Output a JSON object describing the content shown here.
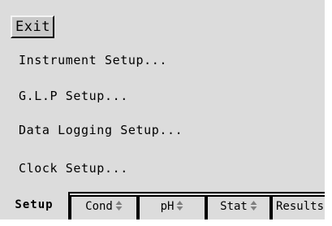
{
  "exit_button": {
    "label": "Exit"
  },
  "menu": {
    "items": [
      {
        "label": "Instrument Setup..."
      },
      {
        "label": "G.L.P Setup..."
      },
      {
        "label": "Data Logging Setup..."
      },
      {
        "label": "Clock Setup..."
      }
    ]
  },
  "tabs": [
    {
      "label": "Setup",
      "active": true,
      "icon": null
    },
    {
      "label": "Cond",
      "active": false,
      "icon": "sort-up-down-icon"
    },
    {
      "label": "pH",
      "active": false,
      "icon": "sort-up-down-icon"
    },
    {
      "label": "Stat",
      "active": false,
      "icon": "sort-up-down-icon"
    },
    {
      "label": "Results",
      "active": false,
      "icon": null
    }
  ]
}
